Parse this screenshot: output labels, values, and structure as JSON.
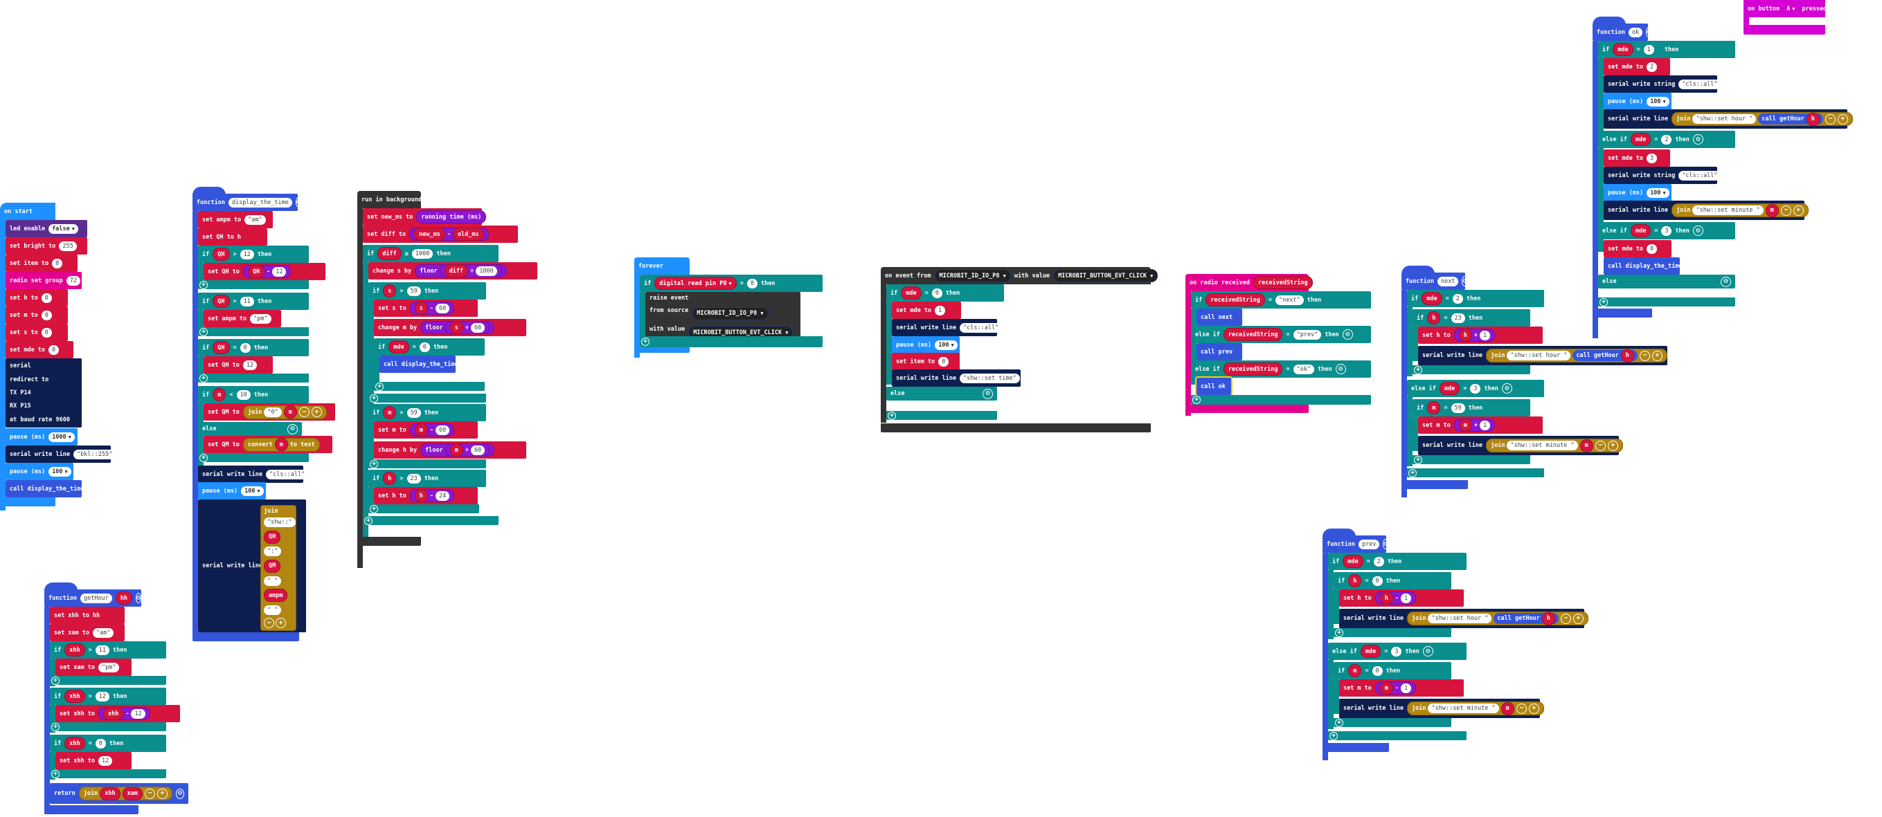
{
  "colors": {
    "led": "#5c2d91",
    "var": "#d6143e",
    "radio": "#e3008c",
    "teal": "#0a8e8e",
    "func": "#3455db",
    "navy": "#0e1f4f",
    "basic": "#1e90ff",
    "dark": "#333333",
    "text": "#b28612",
    "math": "#8b18d0",
    "control": "#333333",
    "event": "#d400d4"
  },
  "on_start": {
    "header": "on start",
    "led_label": "led enable",
    "led_val": "false",
    "bright_set": "set",
    "bright_var": "bright",
    "bright_to": "to",
    "bright_val": "255",
    "item_set": "set",
    "item_var": "item",
    "item_to": "to",
    "item_val": "0",
    "radio_label": "radio set group",
    "radio_val": "72",
    "h_set": "set",
    "h_var": "h",
    "h_to": "to",
    "h_val": "0",
    "m_set": "set",
    "m_var": "m",
    "m_to": "to",
    "m_val": "0",
    "s_set": "set",
    "s_var": "s",
    "s_to": "to",
    "s_val": "0",
    "mde_set": "set",
    "mde_var": "mde",
    "mde_to": "to",
    "mde_val": "0",
    "serial_lines": [
      "serial",
      "redirect to",
      "TX P14",
      "RX P15",
      "at baud rate 9600"
    ],
    "pause1": "pause (ms)",
    "pause1_val": "1000",
    "write_label": "serial write line",
    "write_val": "\"bkl::255\"",
    "pause2": "pause (ms)",
    "pause2_val": "100",
    "call": "call display_the_time"
  },
  "display_the_time": {
    "header": "function",
    "name": "display_the_time",
    "r1": [
      "set",
      "ampm",
      "to",
      "\"am\""
    ],
    "r2": [
      "set",
      "QH",
      "to",
      "h"
    ],
    "if": "if",
    "then": "then",
    "else": "else",
    "c1": [
      "QH",
      ">",
      "12"
    ],
    "s1": [
      "set",
      "QH",
      "to",
      "QH",
      "-",
      "12"
    ],
    "c2": [
      "QH",
      ">",
      "11"
    ],
    "s2": [
      "set",
      "ampm",
      "to",
      "\"pm\""
    ],
    "c3": [
      "QH",
      "=",
      "0"
    ],
    "s3": [
      "set",
      "QH",
      "to",
      "12"
    ],
    "c4": [
      "m",
      "<",
      "10"
    ],
    "s4": [
      "set",
      "QM",
      "to",
      "join",
      "\"0\"",
      "m"
    ],
    "s5": [
      "set",
      "QM",
      "to",
      "convert",
      "m",
      "to text"
    ],
    "w1": "serial write line",
    "w1_val": "\"cls::all\"",
    "p1": "pause (ms)",
    "p1_val": "100",
    "w2": "serial write line",
    "join": "join",
    "join_items": [
      "\"shw::\"",
      "QH",
      "\":\"",
      "QM",
      "\" \"",
      "ampm",
      "\" \""
    ]
  },
  "background": {
    "header": "run in background",
    "r1": [
      "set",
      "new_ms",
      "to",
      "running time (ms)"
    ],
    "r2": [
      "set",
      "diff",
      "to",
      "new_ms",
      "-",
      "old_ms"
    ],
    "c1": [
      "diff",
      "≥",
      "1000"
    ],
    "change1": [
      "change",
      "s",
      "by",
      "floor",
      "diff",
      "÷",
      "1000"
    ],
    "c2": [
      "s",
      ">",
      "59"
    ],
    "s2": [
      "set",
      "s",
      "to",
      "s",
      "-",
      "60"
    ],
    "change2": [
      "change",
      "m",
      "by",
      "floor",
      "s",
      "÷",
      "60"
    ],
    "c3": [
      "mde",
      "=",
      "0"
    ],
    "call": "call display_the_time",
    "c4": [
      "m",
      ">",
      "59"
    ],
    "s4": [
      "set",
      "m",
      "to",
      "m",
      "-",
      "60"
    ],
    "change3": [
      "change",
      "h",
      "by",
      "floor",
      "m",
      "÷",
      "60"
    ],
    "c5": [
      "h",
      ">",
      "23"
    ],
    "s5": [
      "set",
      "h",
      "to",
      "h",
      "-",
      "24"
    ],
    "if": "if",
    "then": "then"
  },
  "getHour": {
    "header": "function",
    "name": "getHour",
    "param": "hh",
    "r1": [
      "set",
      "xhh",
      "to",
      "hh"
    ],
    "r2": [
      "set",
      "xam",
      "to",
      "\"am\""
    ],
    "c1": [
      "xhh",
      ">",
      "11"
    ],
    "s1": [
      "set",
      "xam",
      "to",
      "\"pm\""
    ],
    "c2": [
      "xhh",
      ">",
      "12"
    ],
    "s2": [
      "set",
      "xhh",
      "to",
      "xhh",
      "-",
      "12"
    ],
    "c3": [
      "xhh",
      "=",
      "0"
    ],
    "s3": [
      "set",
      "xhh",
      "to",
      "12"
    ],
    "ret": "return",
    "join": "join",
    "j1": "xhh",
    "j2": "xam",
    "if": "if",
    "then": "then"
  },
  "forever": {
    "header": "forever",
    "if": "if",
    "cond": "digital read pin P8",
    "op": "=",
    "val": "0",
    "then": "then",
    "raise": "raise event",
    "from": "from source",
    "src": "MICROBIT_ID_IO_P8",
    "with": "with value",
    "evt": "MICROBIT_BUTTON_EVT_CLICK"
  },
  "on_event": {
    "header": "on event from",
    "src": "MICROBIT_ID_IO_P8",
    "with": "with value",
    "evt": "MICROBIT_BUTTON_EVT_CLICK",
    "if": "if",
    "c": [
      "mde",
      "=",
      "0"
    ],
    "then": "then",
    "s1": [
      "set",
      "mde",
      "to",
      "1"
    ],
    "w1": "serial write line",
    "w1_val": "\"cls::all\"",
    "p": "pause (ms)",
    "p_val": "100",
    "s2": [
      "set",
      "item",
      "to",
      "0"
    ],
    "w2": "serial write line",
    "w2_val": "\"shw::set time\"",
    "else": "else"
  },
  "radio": {
    "header": "on radio received",
    "param": "receivedString",
    "if": "if",
    "elseif": "else if",
    "then": "then",
    "c1": [
      "receivedString",
      "=",
      "\"next\""
    ],
    "call1": "call next",
    "c2": [
      "receivedString",
      "=",
      "\"prev\""
    ],
    "call2": "call prev",
    "c3": [
      "receivedString",
      "=",
      "\"ok\""
    ],
    "call3": "call ok"
  },
  "next_fn": {
    "header": "function",
    "name": "next",
    "if": "if",
    "elseif": "else if",
    "then": "then",
    "c1": [
      "mde",
      "=",
      "2"
    ],
    "c1b": [
      "h",
      "=",
      "23"
    ],
    "s1": [
      "set",
      "h",
      "to",
      "h",
      "+",
      "1"
    ],
    "w1": "serial write line",
    "join": "join",
    "j1": "\"shw::set hour \"",
    "callHour": "call getHour",
    "h": "h",
    "c2": [
      "mde",
      "=",
      "3"
    ],
    "c2b": [
      "m",
      "=",
      "59"
    ],
    "s2": [
      "set",
      "m",
      "to",
      "m",
      "+",
      "1"
    ],
    "w2": "serial write line",
    "j2": "\"shw::set minute \"",
    "m": "m"
  },
  "prev_fn": {
    "header": "function",
    "name": "prev",
    "if": "if",
    "elseif": "else if",
    "then": "then",
    "c1": [
      "mde",
      "=",
      "2"
    ],
    "c1b": [
      "h",
      "=",
      "0"
    ],
    "s1": [
      "set",
      "h",
      "to",
      "h",
      "-",
      "1"
    ],
    "w1": "serial write line",
    "join": "join",
    "j1": "\"shw::set hour \"",
    "callHour": "call getHour",
    "h": "h",
    "c2": [
      "mde",
      "=",
      "3"
    ],
    "c2b": [
      "m",
      "=",
      "0"
    ],
    "s2": [
      "set",
      "m",
      "to",
      "m",
      "-",
      "1"
    ],
    "w2": "serial write line",
    "j2": "\"shw::set minute \"",
    "m": "m"
  },
  "ok_fn": {
    "header": "function",
    "name": "ok",
    "if": "if",
    "elseif": "else if",
    "else": "else",
    "then": "then",
    "c1": [
      "mde",
      "=",
      "1"
    ],
    "s1": [
      "set",
      "mde",
      "to",
      "2"
    ],
    "w1": "serial write string",
    "w1_val": "\"cls::all\"",
    "p1": "pause (ms)",
    "p1_val": "100",
    "w2": "serial write line",
    "join": "join",
    "j2": "\"shw::set hour \"",
    "callHour": "call getHour",
    "h": "h",
    "c2": [
      "mde",
      "=",
      "2"
    ],
    "s2": [
      "set",
      "mde",
      "to",
      "3"
    ],
    "w3": "serial write string",
    "w3_val": "\"cls::all\"",
    "p2": "pause (ms)",
    "p2_val": "100",
    "w4": "serial write line",
    "j4": "\"shw::set minute \"",
    "m": "m",
    "c3": [
      "mde",
      "=",
      "3"
    ],
    "s3": [
      "set",
      "mde",
      "to",
      "0"
    ],
    "call": "call display_the_time"
  },
  "on_button": {
    "label": "on button",
    "btn": "A",
    "pressed": "pressed"
  }
}
